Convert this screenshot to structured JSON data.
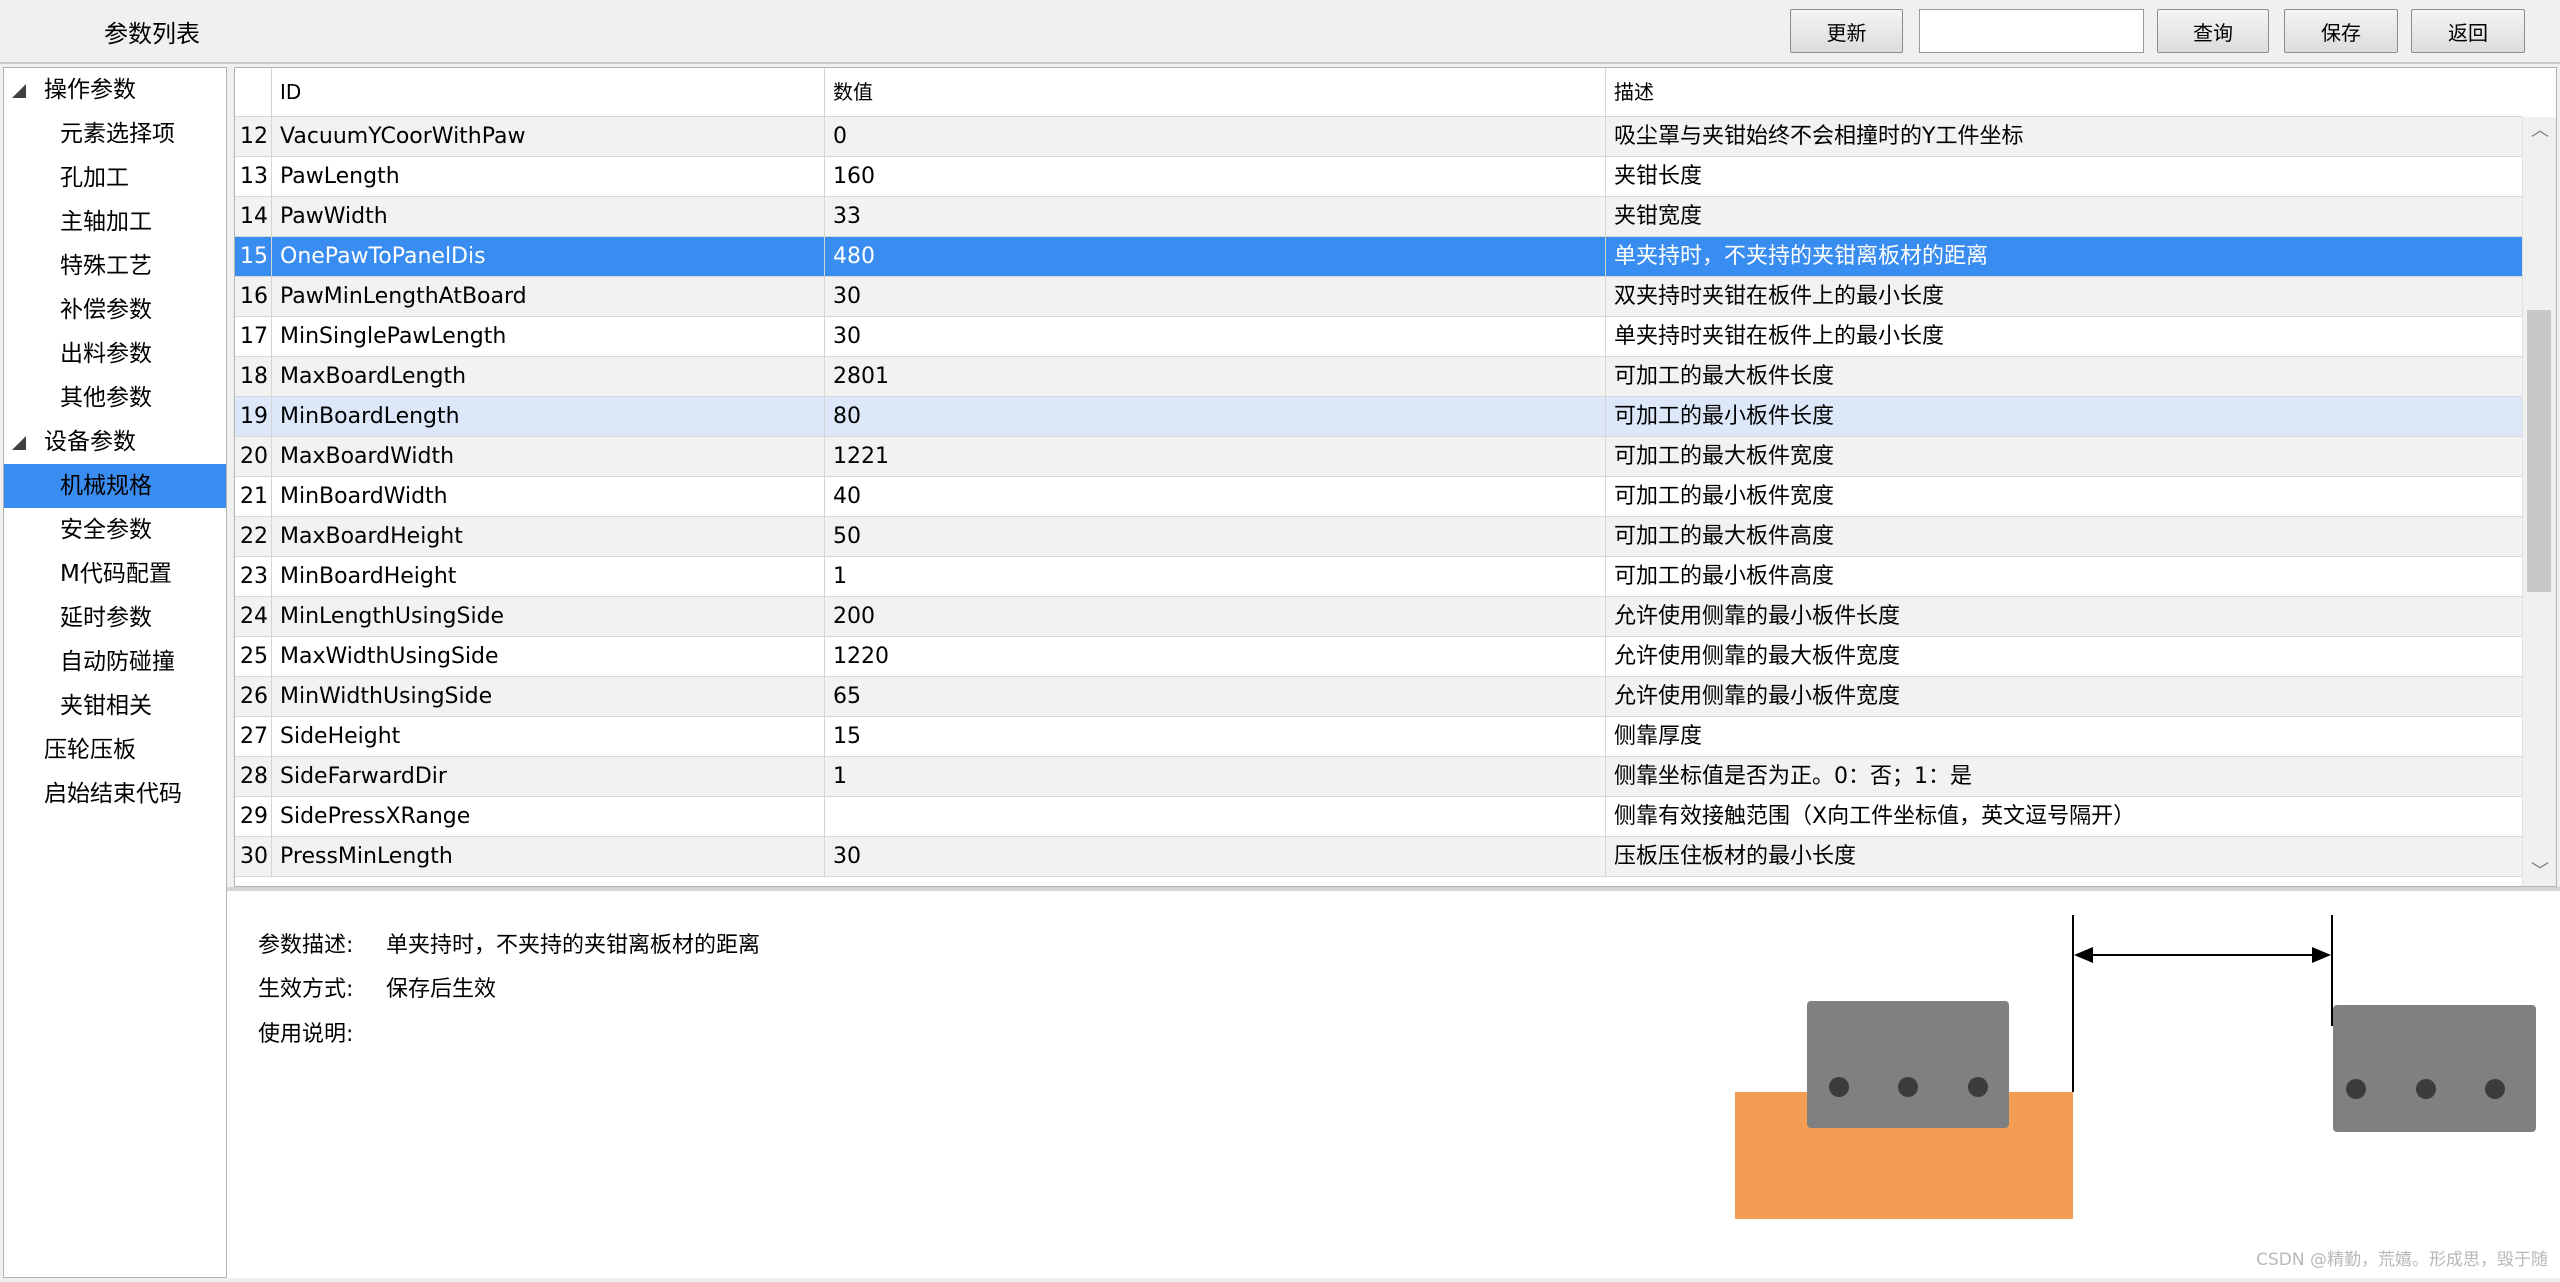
{
  "header": {
    "title": "参数列表",
    "buttons": {
      "update": "更新",
      "query": "查询",
      "save": "保存",
      "back": "返回"
    },
    "search_value": ""
  },
  "tree": [
    {
      "label": "操作参数",
      "level": 1,
      "expanded": true
    },
    {
      "label": "元素选择项",
      "level": 2
    },
    {
      "label": "孔加工",
      "level": 2
    },
    {
      "label": "主轴加工",
      "level": 2
    },
    {
      "label": "特殊工艺",
      "level": 2
    },
    {
      "label": "补偿参数",
      "level": 2
    },
    {
      "label": "出料参数",
      "level": 2
    },
    {
      "label": "其他参数",
      "level": 2
    },
    {
      "label": "设备参数",
      "level": 1,
      "expanded": true
    },
    {
      "label": "机械规格",
      "level": 2,
      "selected": true
    },
    {
      "label": "安全参数",
      "level": 2
    },
    {
      "label": "M代码配置",
      "level": 2
    },
    {
      "label": "延时参数",
      "level": 2
    },
    {
      "label": "自动防碰撞",
      "level": 2
    },
    {
      "label": "夹钳相关",
      "level": 2
    },
    {
      "label": "压轮压板",
      "level": 1
    },
    {
      "label": "启始结束代码",
      "level": 1
    }
  ],
  "grid": {
    "columns": [
      "ID",
      "数值",
      "描述"
    ],
    "selected_row": 15,
    "hover_row": 19,
    "rows": [
      {
        "no": "12",
        "id": "VacuumYCoorWithPaw",
        "value": "0",
        "desc": "吸尘罩与夹钳始终不会相撞时的Y工件坐标"
      },
      {
        "no": "13",
        "id": "PawLength",
        "value": "160",
        "desc": "夹钳长度"
      },
      {
        "no": "14",
        "id": "PawWidth",
        "value": "33",
        "desc": "夹钳宽度"
      },
      {
        "no": "15",
        "id": "OnePawToPanelDis",
        "value": "480",
        "desc": "单夹持时，不夹持的夹钳离板材的距离"
      },
      {
        "no": "16",
        "id": "PawMinLengthAtBoard",
        "value": "30",
        "desc": "双夹持时夹钳在板件上的最小长度"
      },
      {
        "no": "17",
        "id": "MinSinglePawLength",
        "value": "30",
        "desc": "单夹持时夹钳在板件上的最小长度"
      },
      {
        "no": "18",
        "id": "MaxBoardLength",
        "value": "2801",
        "desc": "可加工的最大板件长度"
      },
      {
        "no": "19",
        "id": "MinBoardLength",
        "value": "80",
        "desc": "可加工的最小板件长度"
      },
      {
        "no": "20",
        "id": "MaxBoardWidth",
        "value": "1221",
        "desc": "可加工的最大板件宽度"
      },
      {
        "no": "21",
        "id": "MinBoardWidth",
        "value": "40",
        "desc": "可加工的最小板件宽度"
      },
      {
        "no": "22",
        "id": "MaxBoardHeight",
        "value": "50",
        "desc": "可加工的最大板件高度"
      },
      {
        "no": "23",
        "id": "MinBoardHeight",
        "value": "1",
        "desc": "可加工的最小板件高度"
      },
      {
        "no": "24",
        "id": "MinLengthUsingSide",
        "value": "200",
        "desc": "允许使用侧靠的最小板件长度"
      },
      {
        "no": "25",
        "id": "MaxWidthUsingSide",
        "value": "1220",
        "desc": "允许使用侧靠的最大板件宽度"
      },
      {
        "no": "26",
        "id": "MinWidthUsingSide",
        "value": "65",
        "desc": "允许使用侧靠的最小板件宽度"
      },
      {
        "no": "27",
        "id": "SideHeight",
        "value": "15",
        "desc": "侧靠厚度"
      },
      {
        "no": "28",
        "id": "SideFarwardDir",
        "value": "1",
        "desc": "侧靠坐标值是否为正。0：否；1：是"
      },
      {
        "no": "29",
        "id": "SidePressXRange",
        "value": "",
        "desc": "侧靠有效接触范围（X向工件坐标值，英文逗号隔开）"
      },
      {
        "no": "30",
        "id": "PressMinLength",
        "value": "30",
        "desc": "压板压住板材的最小长度"
      }
    ]
  },
  "detail": {
    "desc_label": "参数描述:",
    "desc_value": "单夹持时，不夹持的夹钳离板材的距离",
    "effect_label": "生效方式:",
    "effect_value": "保存后生效",
    "usage_label": "使用说明:"
  },
  "colors": {
    "selection": "#3a8df0",
    "hover": "#dce8fa",
    "board": "#f39c53",
    "clamp": "#808080",
    "clamp_hole": "#3c3c3c"
  },
  "watermark": "CSDN @精勤，荒嬉。形成思，毁于随"
}
